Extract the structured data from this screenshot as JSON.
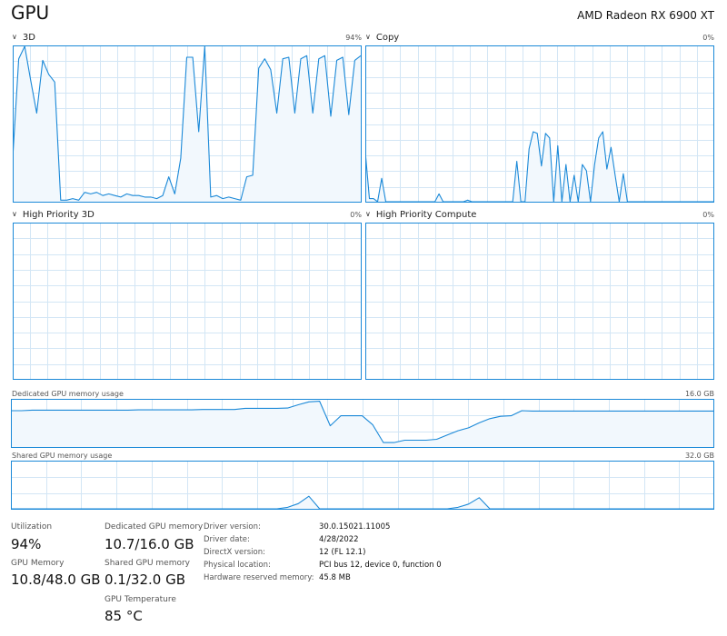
{
  "title": "GPU",
  "device": "AMD Radeon RX 6900 XT",
  "colors": {
    "accent": "#1b89d8",
    "fill": "#f2f8fd",
    "grid": "#d3e6f5",
    "border": "#1b89d8"
  },
  "engines": [
    {
      "name": "3D",
      "value": "94%",
      "series": [
        28,
        92,
        100,
        78,
        57,
        91,
        82,
        77,
        1,
        1,
        2,
        1,
        6,
        5,
        6,
        4,
        5,
        4,
        3,
        5,
        4,
        4,
        3,
        3,
        2,
        4,
        16,
        5,
        28,
        93,
        93,
        45,
        100,
        3,
        4,
        2,
        3,
        2,
        1,
        16,
        17,
        86,
        92,
        85,
        57,
        92,
        93,
        57,
        92,
        94,
        57,
        92,
        94,
        55,
        91,
        93,
        56,
        91,
        94
      ]
    },
    {
      "name": "Copy",
      "value": "0%",
      "series": [
        32,
        2,
        2,
        0,
        15,
        0,
        0,
        0,
        0,
        0,
        0,
        0,
        0,
        0,
        0,
        0,
        0,
        0,
        5,
        0,
        0,
        0,
        0,
        0,
        0,
        1,
        0,
        0,
        0,
        0,
        0,
        0,
        0,
        0,
        0,
        0,
        0,
        26,
        0,
        0,
        34,
        45,
        44,
        23,
        44,
        41,
        0,
        36,
        0,
        24,
        0,
        17,
        0,
        24,
        20,
        0,
        24,
        41,
        45,
        21,
        35,
        17,
        0,
        18,
        0,
        0,
        0,
        0,
        0,
        0,
        0,
        0,
        0,
        0,
        0,
        0,
        0,
        0,
        0,
        0,
        0,
        0,
        0,
        0,
        0,
        0
      ]
    },
    {
      "name": "High Priority 3D",
      "value": "0%",
      "series": []
    },
    {
      "name": "High Priority Compute",
      "value": "0%",
      "series": []
    }
  ],
  "memory_graphs": [
    {
      "name": "Dedicated GPU memory usage",
      "max": "16.0 GB",
      "series": [
        12.3,
        12.3,
        12.5,
        12.5,
        12.5,
        12.5,
        12.5,
        12.5,
        12.5,
        12.5,
        12.5,
        12.5,
        12.6,
        12.6,
        12.6,
        12.6,
        12.6,
        12.6,
        12.7,
        12.7,
        12.7,
        12.7,
        13.1,
        13.1,
        13.1,
        13.1,
        13.2,
        14.3,
        15.3,
        15.5,
        7.2,
        10.6,
        10.6,
        10.6,
        7.5,
        1.5,
        1.5,
        2.3,
        2.3,
        2.3,
        2.6,
        4.1,
        5.5,
        6.5,
        8.2,
        9.6,
        10.4,
        10.6,
        12.3,
        12.2,
        12.2,
        12.2,
        12.2,
        12.2,
        12.2,
        12.2,
        12.2,
        12.2,
        12.2,
        12.2,
        12.2,
        12.2,
        12.2,
        12.2,
        12.2,
        12.2,
        12.2
      ]
    },
    {
      "name": "Shared GPU memory usage",
      "max": "32.0 GB",
      "series": [
        0,
        0,
        0,
        0,
        0,
        0,
        0,
        0,
        0,
        0,
        0,
        0,
        0,
        0,
        0,
        0,
        0,
        0,
        0,
        0,
        0,
        0,
        0,
        0,
        0,
        0,
        1,
        3.5,
        8.5,
        0,
        0,
        0,
        0,
        0,
        0,
        0,
        0,
        0,
        0,
        0,
        0,
        0,
        1,
        3.2,
        7.5,
        0,
        0,
        0,
        0,
        0,
        0,
        0,
        0,
        0,
        0,
        0,
        0,
        0,
        0,
        0,
        0,
        0,
        0,
        0,
        0,
        0,
        0
      ]
    }
  ],
  "stats": {
    "utilization_label": "Utilization",
    "utilization": "94%",
    "gpu_memory_label": "GPU Memory",
    "gpu_memory": "10.8/48.0 GB",
    "dedicated_label": "Dedicated GPU memory",
    "dedicated": "10.7/16.0 GB",
    "shared_label": "Shared GPU memory",
    "shared": "0.1/32.0 GB",
    "temp_label": "GPU Temperature",
    "temp": "85 °C"
  },
  "info": [
    {
      "label": "Driver version:",
      "value": "30.0.15021.11005"
    },
    {
      "label": "Driver date:",
      "value": "4/28/2022"
    },
    {
      "label": "DirectX version:",
      "value": "12 (FL 12.1)"
    },
    {
      "label": "Physical location:",
      "value": "PCI bus 12, device 0, function 0"
    },
    {
      "label": "Hardware reserved memory:",
      "value": "45.8 MB"
    }
  ]
}
